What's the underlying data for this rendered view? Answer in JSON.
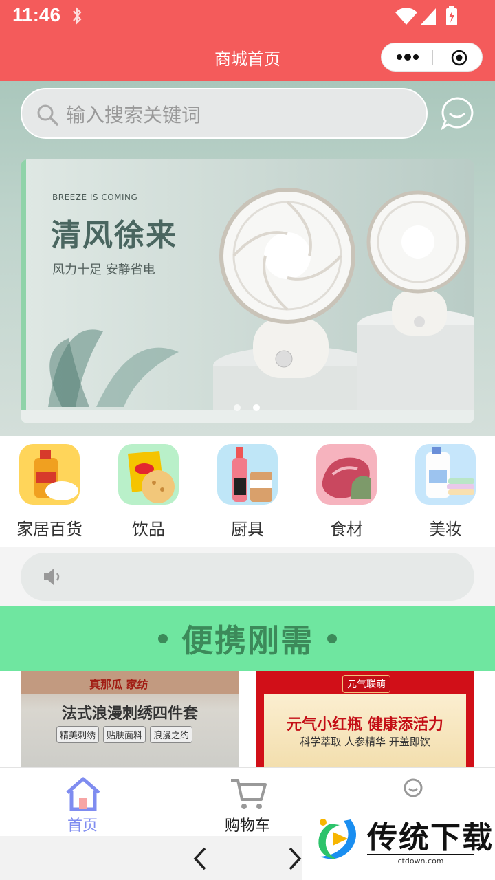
{
  "status": {
    "time": "11:46"
  },
  "titlebar": {
    "title": "商城首页"
  },
  "search": {
    "placeholder": "输入搜索关键词"
  },
  "banner": {
    "eyebrow": "BREEZE IS COMING",
    "headline": "清风徐来",
    "subline": "风力十足 安静省电"
  },
  "categories": [
    {
      "label": "家居百货",
      "icon": "cooking-oil-rice-icon"
    },
    {
      "label": "饮品",
      "icon": "chips-icon"
    },
    {
      "label": "厨具",
      "icon": "bottled-drinks-icon"
    },
    {
      "label": "食材",
      "icon": "meat-icon"
    },
    {
      "label": "美妆",
      "icon": "detergent-towels-icon"
    }
  ],
  "section": {
    "title": "便携刚需"
  },
  "products": [
    {
      "brand": "真那瓜 家纺",
      "title": "法式浪漫刺绣四件套",
      "tags": [
        "精美刺绣",
        "贴肤面料",
        "浪漫之约"
      ]
    },
    {
      "brand": "元气联萌",
      "title": "元气小红瓶 健康添活力",
      "subtitle": "科学萃取 人参精华 开盖即饮"
    }
  ],
  "tabbar": {
    "items": [
      {
        "label": "首页",
        "icon": "home-icon",
        "active": true
      },
      {
        "label": "购物车",
        "icon": "cart-icon",
        "active": false
      },
      {
        "label": "",
        "icon": "user-icon",
        "active": false
      }
    ]
  },
  "watermark": {
    "text": "传统下载",
    "url": "ctdown.com"
  },
  "colors": {
    "brand": "#f45b5b",
    "active_tab": "#7f8cf0",
    "section_bg": "#6fe6a0"
  }
}
